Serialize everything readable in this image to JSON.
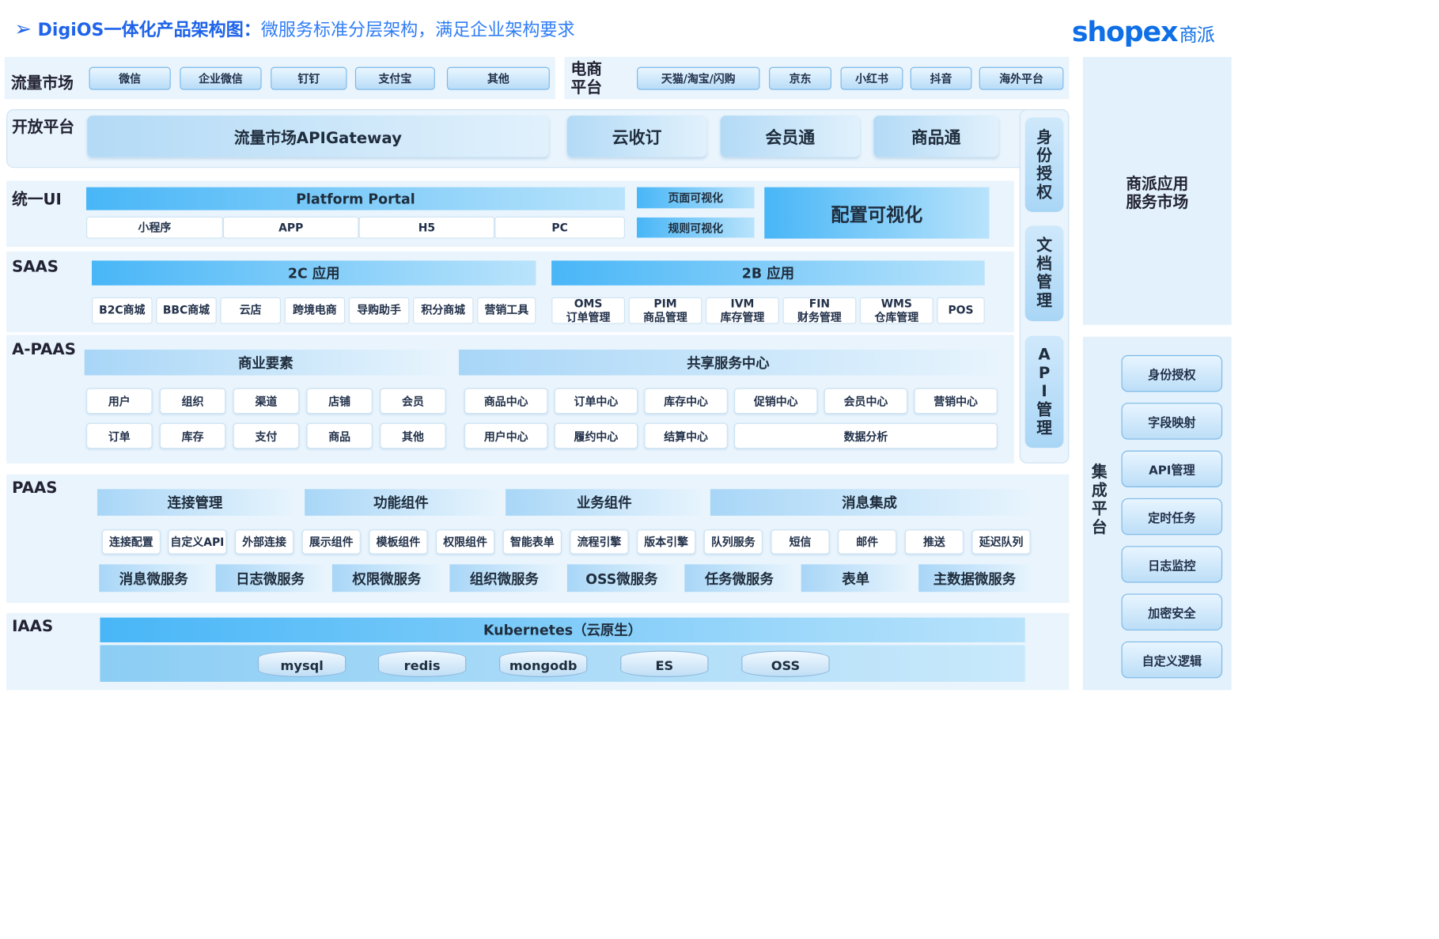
{
  "header": {
    "title_main": "DigiOS一体化产品架构图：",
    "title_sub": "微服务标准分层架构，满足企业架构要求",
    "logo_text": "shopex",
    "logo_cn": "商派"
  },
  "traffic": {
    "label": "流量市场",
    "items": [
      "微信",
      "企业微信",
      "钉钉",
      "支付宝",
      "其他"
    ]
  },
  "ecom": {
    "label_1": "电商",
    "label_2": "平台",
    "items": [
      "天猫/淘宝/闪购",
      "京东",
      "小红书",
      "抖音",
      "海外平台"
    ]
  },
  "open": {
    "label": "开放平台",
    "gateway": "流量市场APIGateway",
    "items": [
      "云收订",
      "会员通",
      "商品通"
    ]
  },
  "ui": {
    "label": "统一UI",
    "portal": "Platform Portal",
    "portal_items": [
      "小程序",
      "APP",
      "H5",
      "PC"
    ],
    "page_vis": "页面可视化",
    "rule_vis": "规则可视化",
    "config_vis": "配置可视化"
  },
  "saas": {
    "label": "SAAS",
    "c2": "2C 应用",
    "b2": "2B 应用",
    "c2_items": [
      "B2C商城",
      "BBC商城",
      "云店",
      "跨境电商",
      "导购助手",
      "积分商城",
      "营销工具"
    ],
    "b2_items": [
      {
        "code": "OMS",
        "name": "订单管理"
      },
      {
        "code": "PIM",
        "name": "商品管理"
      },
      {
        "code": "IVM",
        "name": "库存管理"
      },
      {
        "code": "FIN",
        "name": "财务管理"
      },
      {
        "code": "WMS",
        "name": "仓库管理"
      },
      {
        "code": "POS",
        "name": ""
      }
    ]
  },
  "apaas": {
    "label": "A-PAAS",
    "biz": "商业要素",
    "shared": "共享服务中心",
    "biz_row1": [
      "用户",
      "组织",
      "渠道",
      "店铺",
      "会员"
    ],
    "biz_row2": [
      "订单",
      "库存",
      "支付",
      "商品",
      "其他"
    ],
    "shared_row1": [
      "商品中心",
      "订单中心",
      "库存中心",
      "促销中心",
      "会员中心",
      "营销中心"
    ],
    "shared_row2": [
      "用户中心",
      "履约中心",
      "结算中心",
      "数据分析"
    ]
  },
  "paas": {
    "label": "PAAS",
    "groups": [
      "连接管理",
      "功能组件",
      "业务组件",
      "消息集成"
    ],
    "items": [
      "连接配置",
      "自定义API",
      "外部连接",
      "展示组件",
      "模板组件",
      "权限组件",
      "智能表单",
      "流程引擎",
      "版本引擎",
      "队列服务",
      "短信",
      "邮件",
      "推送",
      "延迟队列"
    ],
    "services": [
      "消息微服务",
      "日志微服务",
      "权限微服务",
      "组织微服务",
      "OSS微服务",
      "任务微服务",
      "表单",
      "主数据微服务"
    ]
  },
  "iaas": {
    "label": "IAAS",
    "k8s": "Kubernetes（云原生）",
    "dbs": [
      "mysql",
      "redis",
      "mongodb",
      "ES",
      "OSS"
    ]
  },
  "vertical": {
    "identity": "身份授权",
    "docs": "文档管理",
    "api": "API管理"
  },
  "market": {
    "line1": "商派应用",
    "line2": "服务市场"
  },
  "integration": {
    "label": "集成平台",
    "items": [
      "身份授权",
      "字段映射",
      "API管理",
      "定时任务",
      "日志监控",
      "加密安全",
      "自定义逻辑"
    ]
  }
}
